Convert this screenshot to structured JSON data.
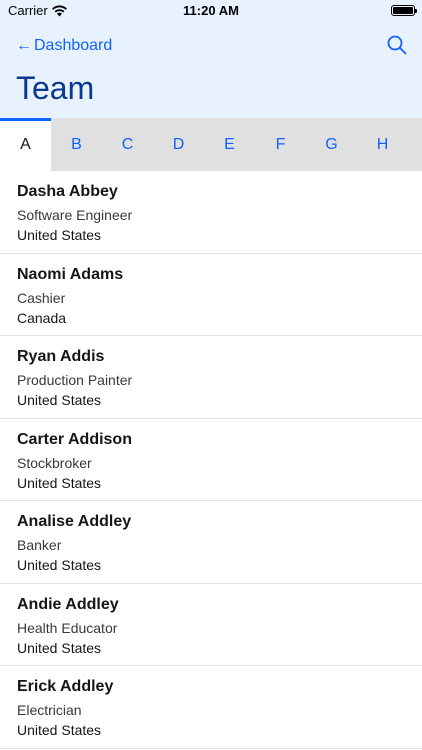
{
  "status_bar": {
    "carrier": "Carrier",
    "time": "11:20 AM"
  },
  "nav": {
    "back_label": "Dashboard",
    "title": "Team"
  },
  "tabs": [
    {
      "label": "A",
      "active": true
    },
    {
      "label": "B",
      "active": false
    },
    {
      "label": "C",
      "active": false
    },
    {
      "label": "D",
      "active": false
    },
    {
      "label": "E",
      "active": false
    },
    {
      "label": "F",
      "active": false
    },
    {
      "label": "G",
      "active": false
    },
    {
      "label": "H",
      "active": false
    }
  ],
  "people": [
    {
      "name": "Dasha Abbey",
      "job": "Software Engineer",
      "country": "United States"
    },
    {
      "name": "Naomi Adams",
      "job": "Cashier",
      "country": "Canada"
    },
    {
      "name": "Ryan Addis",
      "job": "Production Painter",
      "country": "United States"
    },
    {
      "name": "Carter Addison",
      "job": "Stockbroker",
      "country": "United States"
    },
    {
      "name": "Analise Addley",
      "job": "Banker",
      "country": "United States"
    },
    {
      "name": "Andie Addley",
      "job": "Health Educator",
      "country": "United States"
    },
    {
      "name": "Erick Addley",
      "job": "Electrician",
      "country": "United States"
    }
  ],
  "colors": {
    "accent": "#0f62fe",
    "title": "#0a3a8f",
    "header_bg": "#e8f2fe",
    "tab_bg": "#e0e0e0"
  },
  "icons": {
    "back": "arrow-left-icon",
    "search": "search-icon",
    "wifi": "wifi-icon",
    "battery": "battery-icon"
  }
}
